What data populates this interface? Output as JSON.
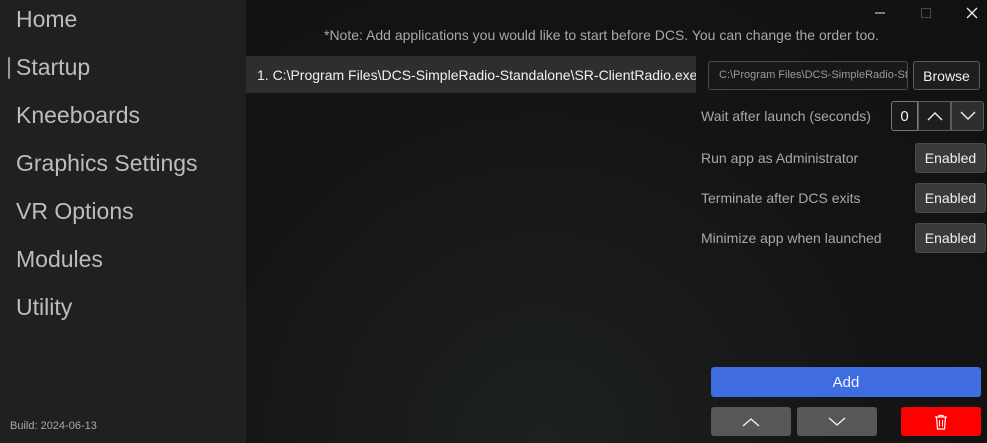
{
  "sidebar": {
    "items": [
      {
        "label": "Home"
      },
      {
        "label": "Startup"
      },
      {
        "label": "Kneeboards"
      },
      {
        "label": "Graphics Settings"
      },
      {
        "label": "VR Options"
      },
      {
        "label": "Modules"
      },
      {
        "label": "Utility"
      }
    ],
    "selected": "Startup",
    "build": "Build: 2024-06-13"
  },
  "main": {
    "note": "*Note: Add applications you would like to start before DCS. You can change the order too.",
    "apps": [
      {
        "label": "1. C:\\Program Files\\DCS-SimpleRadio-Standalone\\SR-ClientRadio.exe"
      }
    ],
    "path_value": "C:\\Program Files\\DCS-SimpleRadio-Standalone\\SR-ClientRadio.exe",
    "browse_label": "Browse",
    "wait_label": "Wait after launch (seconds)",
    "wait_value": "0",
    "admin_label": "Run app as Administrator",
    "admin_state": "Enabled",
    "terminate_label": "Terminate after DCS exits",
    "terminate_state": "Enabled",
    "minimize_label": "Minimize app when launched",
    "minimize_state": "Enabled",
    "add_label": "Add"
  },
  "colors": {
    "accent": "#3f6de0",
    "danger": "#ff0000",
    "sidebar_bg": "#202020",
    "main_bg": "#141414"
  },
  "icons": [
    "minimize-icon",
    "maximize-icon",
    "close-icon",
    "chevron-up-icon",
    "chevron-down-icon",
    "trash-icon"
  ]
}
